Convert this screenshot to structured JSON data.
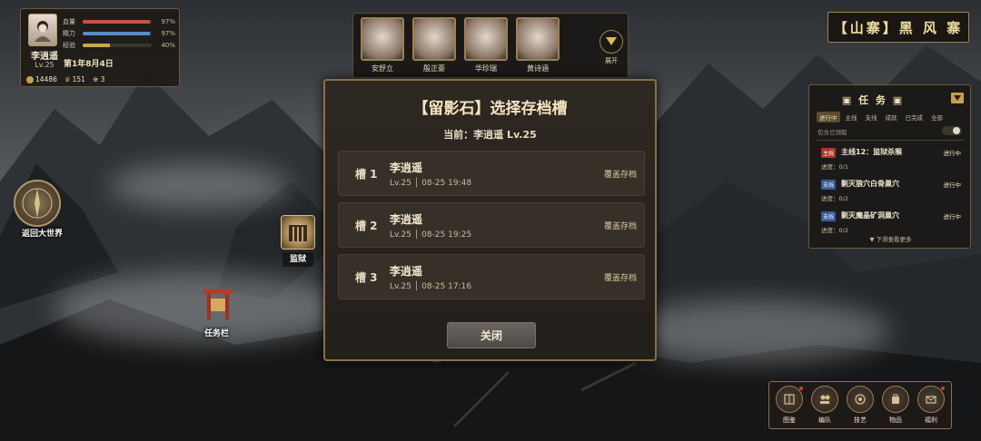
{
  "player": {
    "name": "李逍遥",
    "level": "Lv.25",
    "date": "第1年8月4日",
    "stats": [
      {
        "label": "血量",
        "pct": "97%",
        "value": 0.97,
        "color": "#c85040"
      },
      {
        "label": "精力",
        "pct": "97%",
        "value": 0.97,
        "color": "#5a8ac8"
      },
      {
        "label": "经验",
        "pct": "40%",
        "value": 0.4,
        "color": "#c8a848"
      }
    ],
    "currency": {
      "gold": "14486",
      "items": "151",
      "gems": "3"
    }
  },
  "party": {
    "members": [
      {
        "name": "安舒立"
      },
      {
        "name": "殷正豪"
      },
      {
        "name": "华珍瑞"
      },
      {
        "name": "黄诗涵"
      }
    ],
    "expand_label": "展开"
  },
  "location": {
    "title": "【山寨】黑 风 寨"
  },
  "map": {
    "return_label": "返回大世界",
    "prison_label": "监狱",
    "quest_board_label": "任务栏"
  },
  "quests": {
    "title": "任 务",
    "tabs": [
      "进行中",
      "主线",
      "支线",
      "成就",
      "已完成",
      "全部"
    ],
    "filter_label": "包含已领取",
    "items": [
      {
        "tag": "主线",
        "tag_color": "#a83828",
        "title": "主线12：监狱杀猴",
        "status": "进行中",
        "progress": "进度：0/1"
      },
      {
        "tag": "支线",
        "tag_color": "#3a5a98",
        "title": "剿灭狼穴白骨巢穴",
        "status": "进行中",
        "progress": "进度：0/2"
      },
      {
        "tag": "支线",
        "tag_color": "#3a5a98",
        "title": "剿灭魔晶矿洞巢穴",
        "status": "进行中",
        "progress": "进度：0/2"
      }
    ],
    "more_label": "▼ 下滑查看更多"
  },
  "modal": {
    "title": "【留影石】选择存档槽",
    "current": "当前：李逍遥 Lv.25",
    "slots": [
      {
        "num": "槽 1",
        "name": "李逍遥",
        "meta": "Lv.25 │ 08-25 19:48",
        "action": "覆盖存档"
      },
      {
        "num": "槽 2",
        "name": "李逍遥",
        "meta": "Lv.25 │ 08-25 19:25",
        "action": "覆盖存档"
      },
      {
        "num": "槽 3",
        "name": "李逍遥",
        "meta": "Lv.25 │ 08-25 17:16",
        "action": "覆盖存档"
      }
    ],
    "close_label": "关闭"
  },
  "menu": {
    "items": [
      {
        "label": "图鉴",
        "icon": "book-icon"
      },
      {
        "label": "编队",
        "icon": "team-icon"
      },
      {
        "label": "技艺",
        "icon": "skill-icon"
      },
      {
        "label": "物品",
        "icon": "bag-icon"
      },
      {
        "label": "福利",
        "icon": "gift-icon"
      }
    ]
  }
}
